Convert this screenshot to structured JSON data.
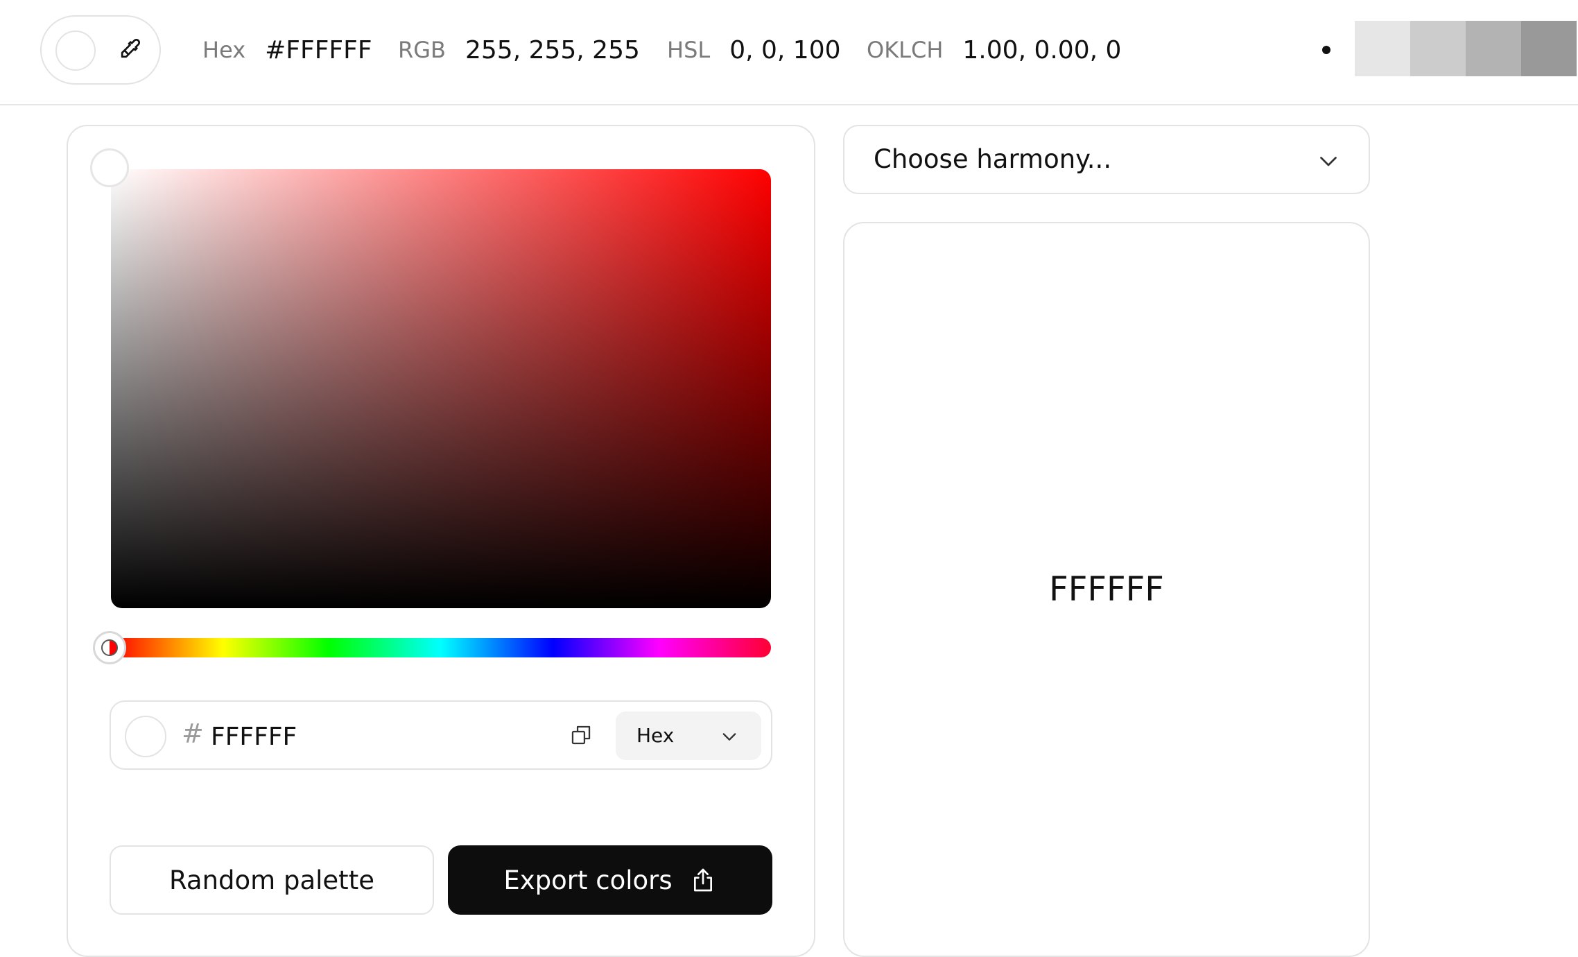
{
  "current_color": "#FFFFFF",
  "top_bar": {
    "eyedropper_icon": "eyedropper-icon",
    "metrics": [
      {
        "label": "Hex",
        "value": "#FFFFFF"
      },
      {
        "label": "RGB",
        "value": "255, 255, 255"
      },
      {
        "label": "HSL",
        "value": "0, 0, 100"
      },
      {
        "label": "OKLCH",
        "value": "1.00, 0.00, 0"
      }
    ],
    "palette_chips": [
      "#e6e6e6",
      "#cccccc",
      "#b3b3b3",
      "#999999"
    ]
  },
  "picker": {
    "hue": 0,
    "saturation": 0,
    "value": 100,
    "hash_symbol": "#",
    "hex_value": "FFFFFF",
    "copy_icon": "copy-icon",
    "format_label": "Hex",
    "format_icon": "chevron-down-icon"
  },
  "actions": {
    "random_label": "Random palette",
    "export_label": "Export colors",
    "export_icon": "share-icon"
  },
  "harmony": {
    "placeholder": "Choose harmony...",
    "icon": "chevron-down-icon"
  },
  "preview": {
    "hex": "FFFFFF"
  },
  "colors": {
    "border": "#e3e3e3",
    "export_button_bg": "#0d0d0d",
    "muted_label": "#7a7a7a"
  }
}
